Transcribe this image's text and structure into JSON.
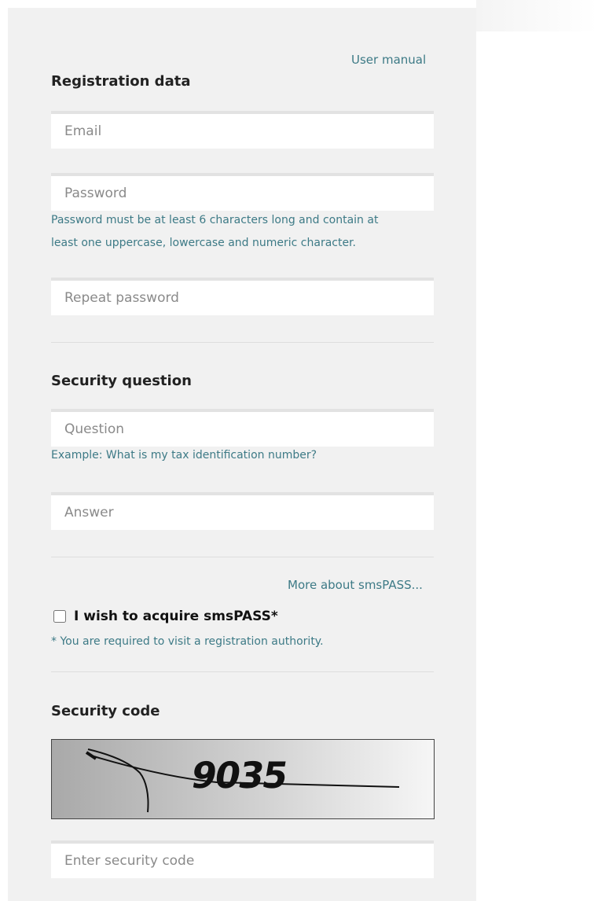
{
  "links": {
    "user_manual": "User manual",
    "more_about_smspass": "More about smsPASS..."
  },
  "registration": {
    "heading": "Registration data",
    "email_placeholder": "Email",
    "password_placeholder": "Password",
    "password_hint_line1": "Password must be at least 6 characters long and contain at",
    "password_hint_line2": "least one uppercase, lowercase and numeric character.",
    "repeat_password_placeholder": "Repeat password"
  },
  "security_question": {
    "heading": "Security question",
    "question_placeholder": "Question",
    "question_hint": "Example: What is my tax identification number?",
    "answer_placeholder": "Answer"
  },
  "smspass": {
    "checkbox_label": "I wish to acquire smsPASS*",
    "checkbox_checked": false,
    "note": "* You are required to visit a registration authority."
  },
  "security_code": {
    "heading": "Security code",
    "captcha_text": "9035",
    "input_placeholder": "Enter security code"
  },
  "colors": {
    "panel_background": "#f1f1f1",
    "link_color": "#3d7a86",
    "heading_color": "#222222"
  }
}
